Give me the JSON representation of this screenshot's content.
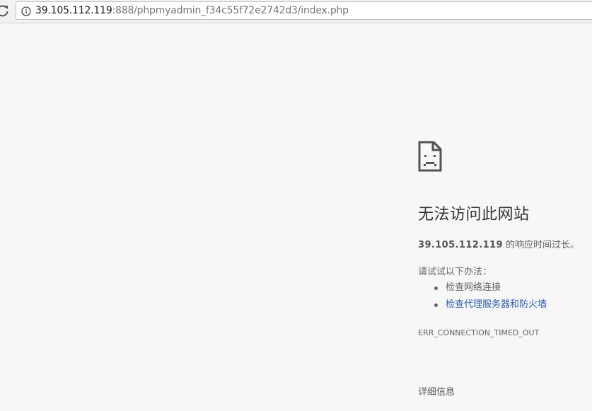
{
  "browser": {
    "url_host": "39.105.112.119",
    "url_rest": ":888/phpmyadmin_f34c55f72e2742d3/index.php",
    "reload_icon": "reload-icon",
    "info_icon": "info-icon"
  },
  "error": {
    "icon": "sad-page-icon",
    "title": "无法访问此网站",
    "summary_host": "39.105.112.119",
    "summary_text": " 的响应时间过长。",
    "try_label": "请试试以下办法：",
    "suggestions": [
      {
        "label": "检查网络连接",
        "link": false
      },
      {
        "label": "检查代理服务器和防火墙",
        "link": true
      }
    ],
    "error_code": "ERR_CONNECTION_TIMED_OUT",
    "details_label": "详细信息"
  },
  "colors": {
    "background": "#f7f7f7",
    "link": "#2a5db0",
    "text": "#646464"
  }
}
